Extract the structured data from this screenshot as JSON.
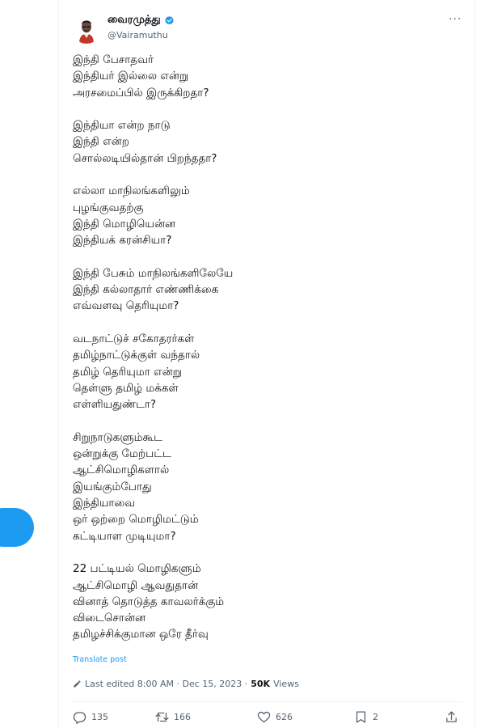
{
  "author": {
    "display_name": "வைரமுத்து",
    "handle": "@Vairamuthu"
  },
  "post": {
    "stanzas": [
      [
        "இந்தி பேசாதவர்",
        "இந்தியர் இல்லை என்று",
        "அரசமைப்பில் இருக்கிறதா?"
      ],
      [
        "இந்தியா என்ற நாடு",
        "இந்தி என்ற",
        "சொல்லடியில்தான் பிறந்ததா?"
      ],
      [
        "எல்லா மாநிலங்களிலும்",
        "புழங்குவதற்கு",
        "இந்தி மொழியென்ன",
        "இந்தியக் கரன்சியா?"
      ],
      [
        "இந்தி பேசும் மாநிலங்களிலேயே",
        "இந்தி கல்லாதார் எண்ணிக்கை",
        "எவ்வளவு தெரியுமா?"
      ],
      [
        "வடநாட்டுச் சகோதரர்கள்",
        "தமிழ்நாட்டுக்குள் வந்தால்",
        "தமிழ் தெரியுமா என்று",
        "தெள்ளு தமிழ் மக்கள்",
        "எள்ளியதுண்டா?"
      ],
      [
        "சிறுநாடுகளும்கூட",
        "ஒன்றுக்கு மேற்பட்ட",
        "ஆட்சிமொழிகளால்",
        "இயங்கும்போது",
        "இந்தியாவை",
        "ஒர் ஒற்றை மொழிமட்டும்",
        "கட்டியாள முடியுமா?"
      ],
      [
        "22 பட்டியல் மொழிகளும்",
        "ஆட்சிமொழி ஆவதுதான்",
        "வினாத் தொடுத்த காவலர்க்கும்",
        "விடைசொன்ன",
        "தமிழச்சிக்குமான ஒரே தீர்வு"
      ]
    ],
    "translate_label": "Translate post",
    "edited_prefix": "Last edited 8:00 AM · Dec 15, 2023 · ",
    "views_count": "50K",
    "views_label": " Views"
  },
  "actions": {
    "replies": "135",
    "reposts": "166",
    "likes": "626",
    "bookmarks": "2"
  },
  "colors": {
    "accent": "#1d9bf0",
    "text": "#0f1419",
    "muted": "#536471"
  },
  "icons": [
    "more-icon",
    "verified-badge-icon",
    "pencil-icon",
    "reply-icon",
    "repost-icon",
    "like-icon",
    "bookmark-icon",
    "share-icon"
  ]
}
